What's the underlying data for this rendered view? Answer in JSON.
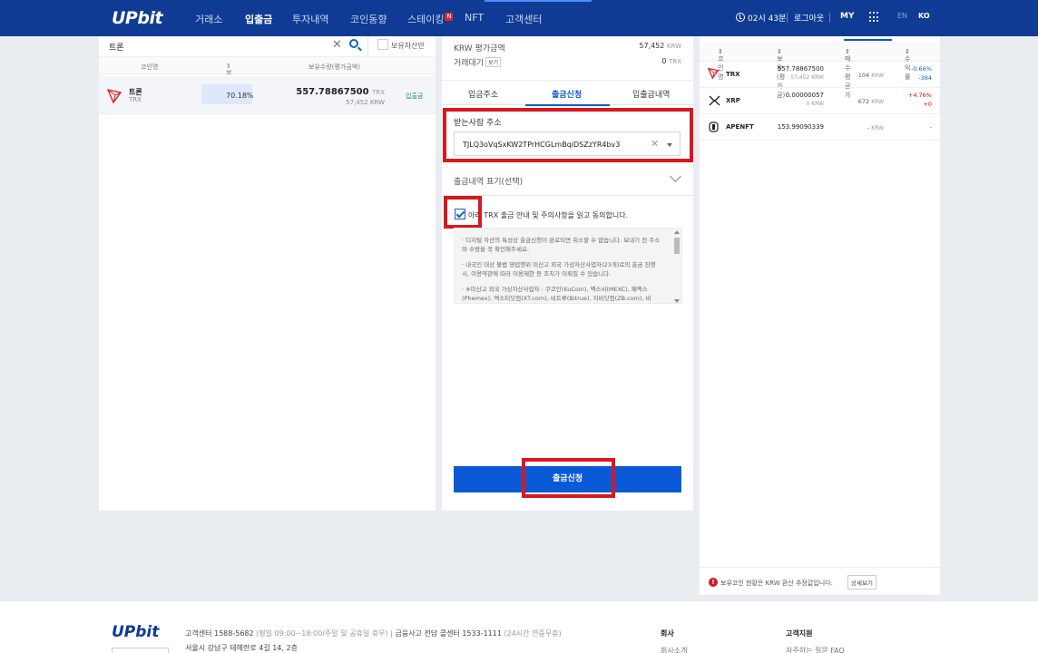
{
  "header": {
    "logo": "UPbit",
    "nav": [
      "거래소",
      "입출금",
      "투자내역",
      "코인동향",
      "스테이킹",
      "NFT",
      "고객센터"
    ],
    "nav_new_badge": "N",
    "time_left": "02시 43분",
    "logout": "로그아웃",
    "my": "MY",
    "lang_en": "EN",
    "lang_ko": "KO"
  },
  "left": {
    "search_value": "트론",
    "hide_small_label": "보유자산만",
    "columns": [
      "코인명",
      "보유비중",
      "보유수량(평가금액)"
    ],
    "row": {
      "name": "트론",
      "symbol": "TRX",
      "ratio": "70.18%",
      "amount": "557.78867500",
      "amount_unit": "TRX",
      "krw": "57,452",
      "krw_unit": "KRW",
      "action": "입출금"
    }
  },
  "middle": {
    "eval_label": "KRW 평가금액",
    "eval_value": "57,452",
    "eval_unit": "KRW",
    "pending_label": "거래대기",
    "pending_btn": "보기",
    "pending_value": "0",
    "pending_unit": "TRX",
    "tabs": [
      "입금주소",
      "출금신청",
      "입출금내역"
    ],
    "recv_label": "받는사람 주소",
    "address": "TJLQ3oVqSxKW2TPrHCGLmBqiDSZzYR4bv3",
    "memo_label": "출금내역 표기(선택)",
    "agree_text": "아래 TRX 출금 안내 및 주의사항을 읽고 동의합니다.",
    "notices": [
      "디지털 자산의 특성상 출금신청이 완료되면 취소할 수 없습니다. 보내기 전 주소와 수량을 꼭 확인해주세요.",
      "내국인 대상 불법 영업행위 미신고 외국 가상자산사업자(23개)로의 출금 진행 시, 이용약관에 따라 이용제한 등 조치가 이뤄질 수 있습니다.",
      "※미신고 외국 가상자산사업자 : 쿠코인(KuCoin), 멕스씨(MEXC), 페멕스(Phemex), 엑스티닷컴(XT.com), 비트루(Bitrue), 지비닷컴(ZB.com), 비"
    ],
    "submit_label": "출금신청"
  },
  "right": {
    "columns": [
      "코인명",
      "보유(평가금)",
      "매수평균가",
      "수익률"
    ],
    "rows": [
      {
        "symbol": "TRX",
        "amount": "557.78867500",
        "krw": "57,452 KRW",
        "avg": "104",
        "avg_unit": "KRW",
        "pct": "-0.66%",
        "pnl": "-384",
        "trend": "neg"
      },
      {
        "symbol": "XRP",
        "amount": "0.00000057",
        "krw": "0 KRW",
        "avg": "672",
        "avg_unit": "KRW",
        "pct": "+4.76%",
        "pnl": "+0",
        "trend": "pos"
      },
      {
        "symbol": "APENFT",
        "amount": "153.99090339",
        "krw": "",
        "avg": "-",
        "avg_unit": "KRW",
        "pct": "-",
        "pnl": "",
        "trend": "none"
      }
    ],
    "footer_note": "보유코인 현황은 KRW 환산 추정값입니다.",
    "footer_btn": "상세보기"
  },
  "footer": {
    "logo": "UPbit",
    "cs": "고객센터 1588-5682",
    "cs_hours": "(평일 09:00~18:00/주말 및 공휴일 휴무)",
    "fraud": "금융사고 전담 콜센터 1533-1111",
    "fraud_hours": "(24시간 연중무휴)",
    "address": "서울시 강남구 테헤란로 4길 14, 2층",
    "company_head": "회사",
    "company_sub": "회사소개",
    "support_head": "고객지원",
    "support_sub": "자주하는 질문 FAQ"
  },
  "colors": {
    "brand": "#0f3b94",
    "accent": "#0a5ad8",
    "highlight": "#d7181f",
    "negative": "#1261c4",
    "positive": "#d60000"
  }
}
